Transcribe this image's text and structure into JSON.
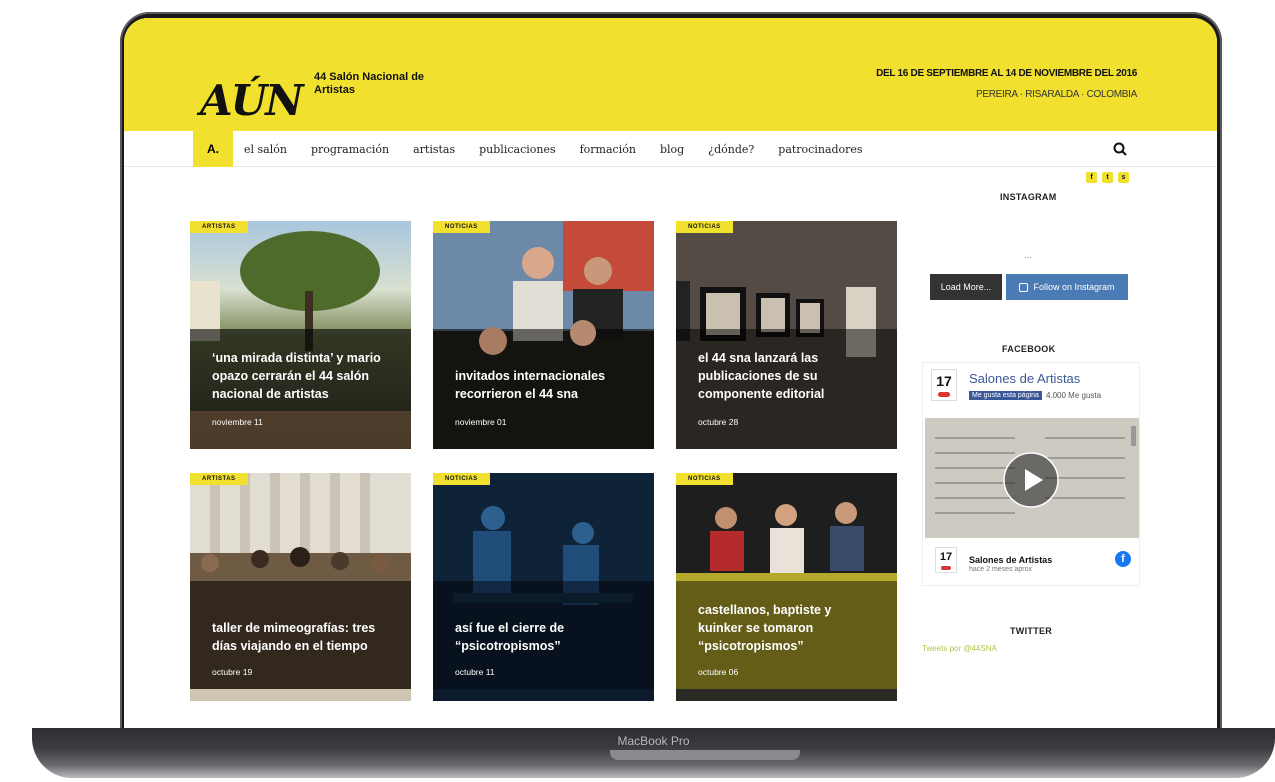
{
  "site": {
    "logo": "AÚN",
    "logo_subtitle": "44 Salón Nacional de Artistas",
    "dates": "DEL 16 DE SEPTIEMBRE AL 14 DE NOVIEMBRE DEL 2016",
    "place": "PEREIRA · RISARALDA · COLOMBIA"
  },
  "nav": {
    "home_label": "A.",
    "items": [
      "el salón",
      "programación",
      "artistas",
      "publicaciones",
      "formación",
      "blog",
      "¿dónde?",
      "patrocinadores"
    ]
  },
  "cards": [
    {
      "badge": "ARTISTAS",
      "title": "‘una mirada distinta’ y mario opazo cerrarán el 44 salón nacional de artistas",
      "date": "noviembre 11"
    },
    {
      "badge": "NOTICIAS",
      "title": "invitados internacionales recorrieron el 44 sna",
      "date": "noviembre 01"
    },
    {
      "badge": "NOTICIAS",
      "title": "el 44 sna lanzará las publicaciones de su componente editorial",
      "date": "octubre 28"
    },
    {
      "badge": "ARTISTAS",
      "title": "taller de mimeografías: tres días viajando en el tiempo",
      "date": "octubre 19"
    },
    {
      "badge": "NOTICIAS",
      "title": "así fue el cierre de “psicotropismos”",
      "date": "octubre 11"
    },
    {
      "badge": "NOTICIAS",
      "title": "castellanos, baptiste y kuinker se tomaron “psicotropismos”",
      "date": "octubre 06"
    }
  ],
  "sidebar": {
    "social": [
      "f",
      "t",
      "s"
    ],
    "instagram_title": "INSTAGRAM",
    "insta_loader": "...",
    "load_more": "Load More...",
    "follow": "Follow on Instagram",
    "facebook_title": "FACEBOOK",
    "fb_cal_day": "17",
    "fb_page_name": "Salones de Artistas",
    "fb_like": "Me gusta esta página",
    "fb_likes_count": "4.000 Me gusta",
    "fb_footer_name": "Salones de Artistas",
    "fb_footer_sub": "hace 2 meses aprox",
    "twitter_title": "TWITTER",
    "twitter_link": "Tweets por @44SNA"
  },
  "device": {
    "label": "MacBook Pro"
  },
  "colors": {
    "brand_yellow": "#f2e02e",
    "facebook_blue": "#3b5998",
    "instagram_blue": "#4a7bb5"
  }
}
